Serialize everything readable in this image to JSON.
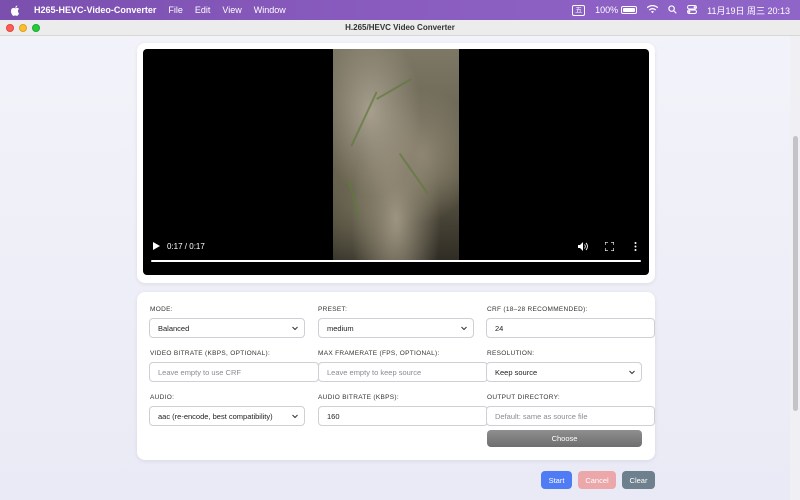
{
  "menubar": {
    "app_name": "H265-HEVC-Video-Converter",
    "menus": [
      "File",
      "Edit",
      "View",
      "Window"
    ],
    "input_method": "五",
    "battery": "100%",
    "datetime": "11月19日 周三  20:13"
  },
  "window": {
    "title": "H.265/HEVC Video Converter"
  },
  "video": {
    "time": "0:17 / 0:17",
    "progress": 1.0
  },
  "form": {
    "mode": {
      "label": "MODE:",
      "value": "Balanced"
    },
    "preset": {
      "label": "PRESET:",
      "value": "medium"
    },
    "crf": {
      "label": "CRF (18–28 RECOMMENDED):",
      "value": "24"
    },
    "video_bitrate": {
      "label": "VIDEO BITRATE (KBPS, OPTIONAL):",
      "placeholder": "Leave empty to use CRF"
    },
    "max_framerate": {
      "label": "MAX FRAMERATE (FPS, OPTIONAL):",
      "placeholder": "Leave empty to keep source"
    },
    "resolution": {
      "label": "RESOLUTION:",
      "value": "Keep source"
    },
    "audio": {
      "label": "AUDIO:",
      "value": "aac (re-encode, best compatibility)"
    },
    "audio_bitrate": {
      "label": "AUDIO BITRATE (KBPS):",
      "value": "160"
    },
    "output_dir": {
      "label": "OUTPUT DIRECTORY:",
      "placeholder": "Default: same as source file"
    },
    "choose_label": "Choose"
  },
  "actions": {
    "start": "Start",
    "cancel": "Cancel",
    "clear": "Clear"
  },
  "colors": {
    "start": "#4f7cf4",
    "cancel": "#eba7a9",
    "clear": "#6e7f8d"
  }
}
